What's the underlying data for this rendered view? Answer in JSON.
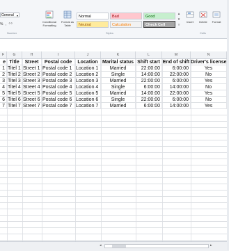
{
  "ribbon": {
    "number_format": "General",
    "number_label": "Number",
    "conditional_formatting": "Conditional Formatting",
    "format_as_table": "Format as Table",
    "styles_label": "Styles",
    "cells_label": "Cells",
    "styles": {
      "normal": "Normal",
      "bad": "Bad",
      "good": "Good",
      "neutral": "Neutral",
      "calculation": "Calculation",
      "check_cell": "Check Cell"
    },
    "insert": "Insert",
    "delete": "Delete",
    "format": "Format"
  },
  "columns": [
    "F",
    "G",
    "H",
    "I",
    "J",
    "K",
    "L",
    "M",
    "N"
  ],
  "header": [
    "e",
    "Title",
    "Street",
    "Postal code",
    "Location",
    "Marital status",
    "Shift start",
    "End of shift",
    "Driver's license"
  ],
  "rows": [
    [
      "1",
      "Titel 1",
      "Street 1",
      "Postal code 1",
      "Location 1",
      "Married",
      "22:00:00",
      "6:00:00",
      "Yes"
    ],
    [
      "2",
      "Titel 2",
      "Street 2",
      "Postal code 2",
      "Location 2",
      "Single",
      "14:00:00",
      "22:00:00",
      "No"
    ],
    [
      "3",
      "Titel 3",
      "Street 3",
      "Postal code 3",
      "Location 3",
      "Married",
      "22:00:00",
      "6:00:00",
      "Yes"
    ],
    [
      "4",
      "Titel 4",
      "Street 4",
      "Postal code 4",
      "Location 4",
      "Single",
      "6:00:00",
      "14:00:00",
      "No"
    ],
    [
      "5",
      "Titel 5",
      "Street 5",
      "Postal code 5",
      "Location 5",
      "Married",
      "14:00:00",
      "22:00:00",
      "Yes"
    ],
    [
      "6",
      "Titel 6",
      "Street 6",
      "Postal code 6",
      "Location 6",
      "Single",
      "22:00:00",
      "6:00:00",
      "No"
    ],
    [
      "7",
      "Titel 7",
      "Street 7",
      "Postal code 7",
      "Location 7",
      "Married",
      "6:00:00",
      "14:00:00",
      "Yes"
    ]
  ],
  "colors": {
    "good_fill": "#c6efce",
    "bad_fill": "#ffc7ce",
    "neutral_fill": "#ffeb9c",
    "check_fill": "#a5a5a5"
  }
}
